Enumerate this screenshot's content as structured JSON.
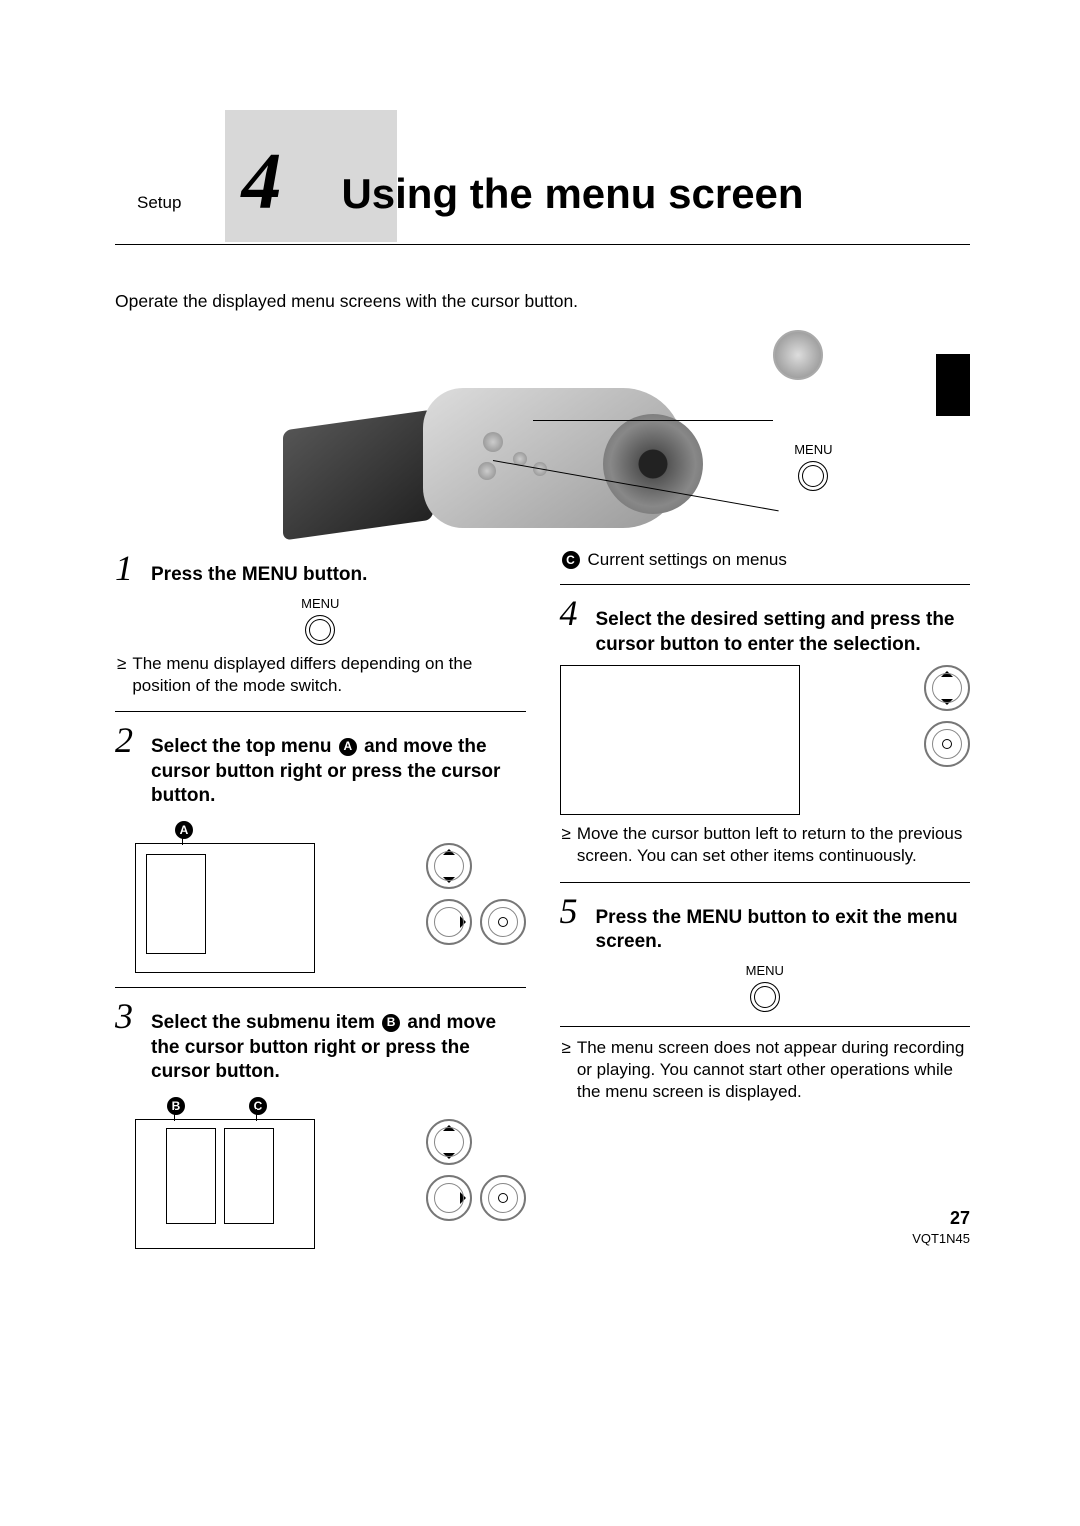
{
  "header": {
    "section_label": "Setup",
    "chapter_number": "4",
    "chapter_title": "Using the menu screen"
  },
  "intro_text": "Operate the displayed menu screens with the cursor button.",
  "menu_label": "MENU",
  "label_c_desc": "Current settings on menus",
  "steps": {
    "s1": {
      "num": "1",
      "title": "Press the MENU button.",
      "note": "The menu displayed differs depending on the position of the mode switch."
    },
    "s2": {
      "num": "2",
      "title_pre": "Select the top menu ",
      "title_mid_label": "A",
      "title_post": " and move the cursor button right or press the cursor button."
    },
    "s3": {
      "num": "3",
      "title_pre": "Select the submenu item ",
      "title_mid_label": "B",
      "title_post": " and move the cursor button right or press the cursor button."
    },
    "s4": {
      "num": "4",
      "title": "Select the desired setting and press the cursor button to enter the selection.",
      "note": "Move the cursor button left to return to the previous screen. You can set other items continuously."
    },
    "s5": {
      "num": "5",
      "title": "Press the MENU button to exit the menu screen.",
      "note": "The menu screen does not appear during recording or playing. You cannot start other operations while the menu screen is displayed."
    }
  },
  "labels": {
    "A": "A",
    "B": "B",
    "C": "C"
  },
  "footer": {
    "page": "27",
    "docid": "VQT1N45"
  }
}
